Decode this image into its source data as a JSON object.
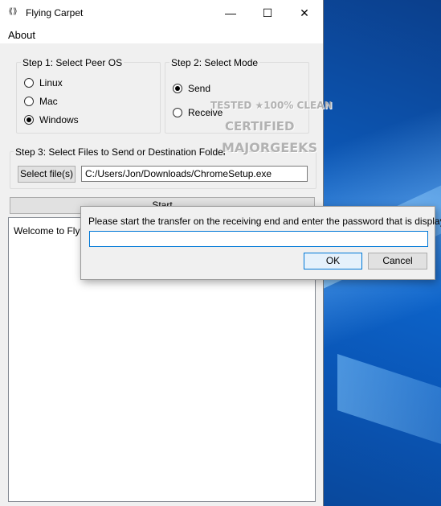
{
  "window": {
    "title": "Flying Carpet",
    "controls": {
      "minimize": "—",
      "maximize": "☐",
      "close": "✕"
    },
    "menu": {
      "about": "About"
    }
  },
  "step1": {
    "title": "Step 1: Select Peer OS",
    "options": [
      "Linux",
      "Mac",
      "Windows"
    ],
    "selected": "Windows"
  },
  "step2": {
    "title": "Step 2: Select Mode",
    "options": [
      "Send",
      "Receive"
    ],
    "selected": "Send"
  },
  "step3": {
    "title": "Step 3: Select Files to Send or Destination Folder",
    "select_button": "Select file(s)",
    "path_value": "C:/Users/Jon/Downloads/ChromeSetup.exe"
  },
  "start_button": "Start",
  "log": {
    "text": "Welcome to Flying"
  },
  "watermark": {
    "line1": "TESTED ★100% CLEAN",
    "line2": "CERTIFIED",
    "line3": "MAJORGEEKS"
  },
  "dialog": {
    "message": "Please start the transfer on the receiving end and enter the password that is displayed.",
    "input_value": "",
    "ok": "OK",
    "cancel": "Cancel"
  }
}
